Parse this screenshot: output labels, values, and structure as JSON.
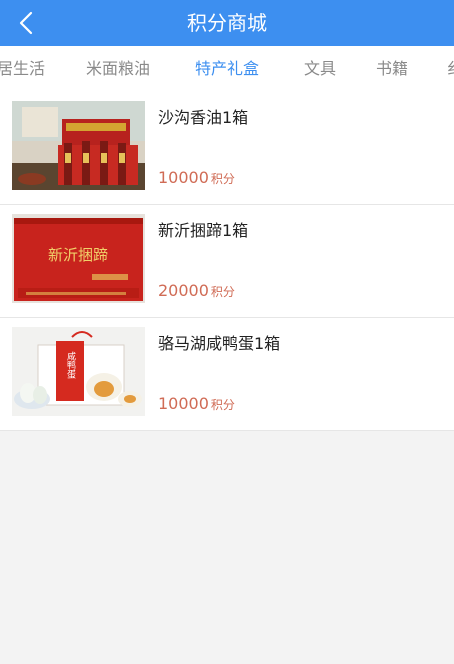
{
  "header": {
    "title": "积分商城"
  },
  "tabs": [
    "居生活",
    "米面粮油",
    "特产礼盒",
    "文具",
    "书籍",
    "纟"
  ],
  "active_tab": "特产礼盒",
  "items": [
    {
      "name": "沙沟香油1箱",
      "points": "10000",
      "unit": "积分"
    },
    {
      "name": "新沂捆蹄1箱",
      "points": "20000",
      "unit": "积分",
      "image_text": "新沂捆蹄"
    },
    {
      "name": "骆马湖咸鸭蛋1箱",
      "points": "10000",
      "unit": "积分",
      "image_text": "咸鸭蛋"
    }
  ],
  "colors": {
    "accent": "#3d8ff0",
    "price": "#d06b55"
  },
  "icons": {
    "back": "chevron-left-icon"
  }
}
